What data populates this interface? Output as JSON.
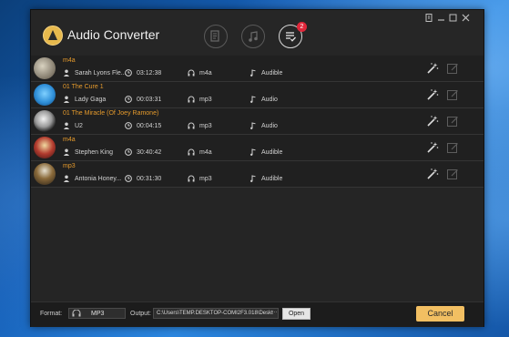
{
  "app": {
    "title": "Audio Converter"
  },
  "toolbar": {
    "icons": [
      "convert-file-icon",
      "music-note-icon",
      "converted-list-icon"
    ],
    "badge_count": "2"
  },
  "window_controls": [
    "menu-icon",
    "minimize-icon",
    "maximize-icon",
    "close-icon"
  ],
  "rows": [
    {
      "title": "m4a",
      "author": "Sarah Lyons Fle...",
      "duration": "03:12:38",
      "format": "m4a",
      "source": "Audible"
    },
    {
      "title": "01 The Cure 1",
      "author": "Lady Gaga",
      "duration": "00:03:31",
      "format": "mp3",
      "source": "Audio"
    },
    {
      "title": "01 The Miracle (Of Joey Ramone)",
      "author": "U2",
      "duration": "00:04:15",
      "format": "mp3",
      "source": "Audio"
    },
    {
      "title": "m4a",
      "author": "Stephen King",
      "duration": "30:40:42",
      "format": "m4a",
      "source": "Audible"
    },
    {
      "title": "mp3",
      "author": "Antonia Honey...",
      "duration": "00:31:30",
      "format": "mp3",
      "source": "Audible"
    }
  ],
  "bottom": {
    "format_label": "Format:",
    "format_value": "MP3",
    "output_label": "Output:",
    "output_value": "C:\\Users\\TEMP.DESKTOP-COMI2F3.018\\Deskt",
    "browse_label": "···",
    "open_label": "Open",
    "cancel_label": "Cancel"
  },
  "colors": {
    "title_accent": "#e59a2c",
    "cancel_button": "#f2bf62",
    "badge": "#e0273a"
  }
}
